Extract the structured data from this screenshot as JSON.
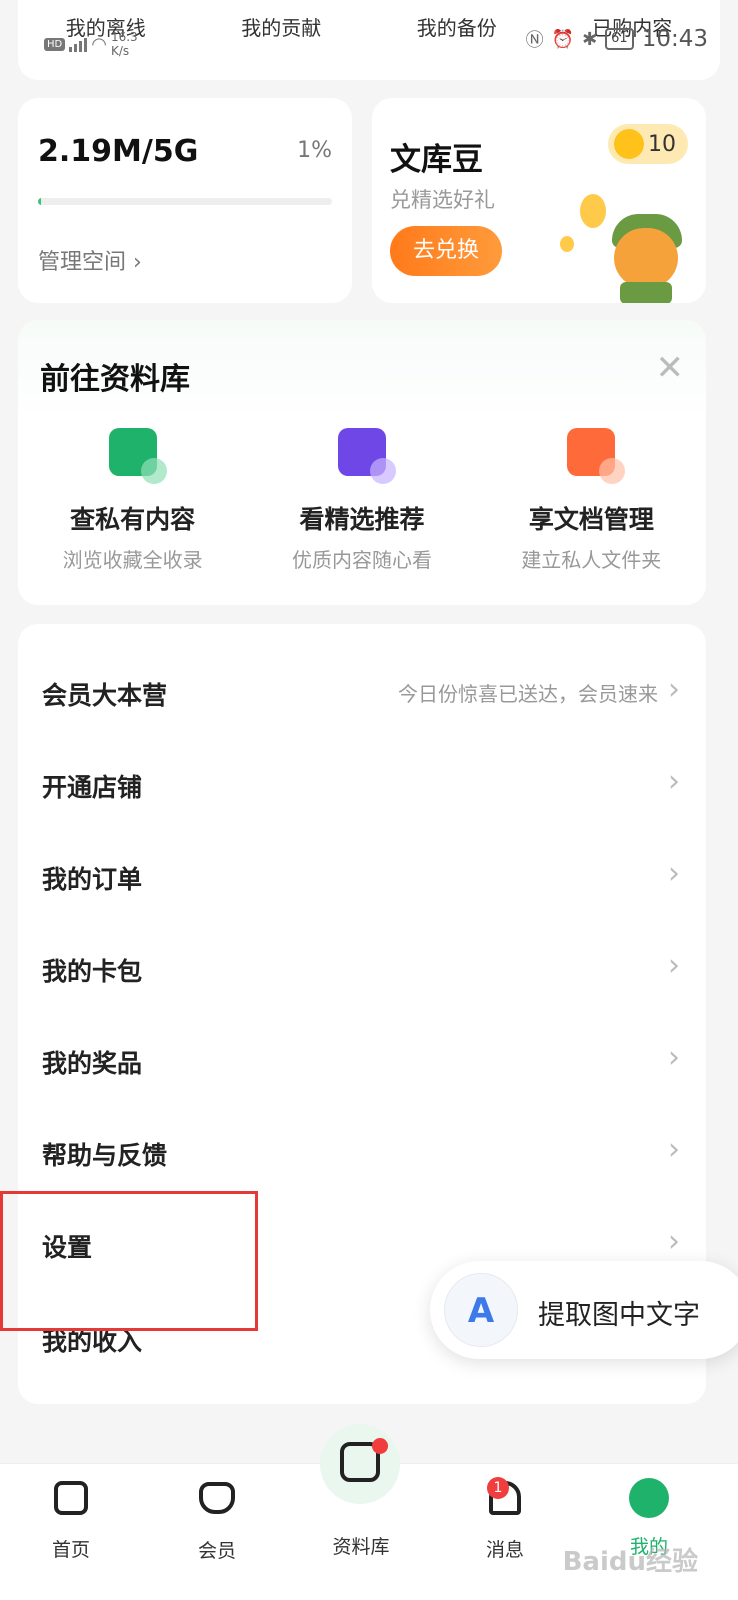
{
  "status_bar": {
    "hd": "HD",
    "speed": "16.3\nK/s",
    "battery": "61",
    "time": "10:43"
  },
  "top_links": [
    "我的离线",
    "我的贡献",
    "我的备份",
    "已购内容"
  ],
  "storage": {
    "value": "2.19M/5G",
    "percent": "1%",
    "fill_fraction": 0.01,
    "manage_label": "管理空间 ›"
  },
  "beans": {
    "title": "文库豆",
    "subtitle": "兑精选好礼",
    "button": "去兑换",
    "count": "10"
  },
  "library": {
    "title": "前往资料库",
    "close": "✕",
    "items": [
      {
        "name": "查私有内容",
        "sub": "浏览收藏全收录"
      },
      {
        "name": "看精选推荐",
        "sub": "优质内容随心看"
      },
      {
        "name": "享文档管理",
        "sub": "建立私人文件夹"
      }
    ]
  },
  "menu": {
    "items": [
      {
        "label": "会员大本营",
        "hint": "今日份惊喜已送达，会员速来"
      },
      {
        "label": "开通店铺",
        "hint": ""
      },
      {
        "label": "我的订单",
        "hint": ""
      },
      {
        "label": "我的卡包",
        "hint": ""
      },
      {
        "label": "我的奖品",
        "hint": ""
      },
      {
        "label": "帮助与反馈",
        "hint": ""
      },
      {
        "label": "设置",
        "hint": ""
      },
      {
        "label": "我的收入",
        "hint": ""
      }
    ],
    "chevron": "›"
  },
  "ocr": {
    "icon_letter": "A",
    "label": "提取图中文字"
  },
  "bottom_nav": {
    "items": [
      {
        "label": "首页"
      },
      {
        "label": "会员"
      },
      {
        "label": "资料库"
      },
      {
        "label": "消息",
        "badge": "1"
      },
      {
        "label": "我的"
      }
    ]
  },
  "watermark": "Baidu经验",
  "colors": {
    "brand_green": "#1fb26b",
    "highlight_red": "#e53935",
    "button_orange": "#ff7a1a"
  }
}
